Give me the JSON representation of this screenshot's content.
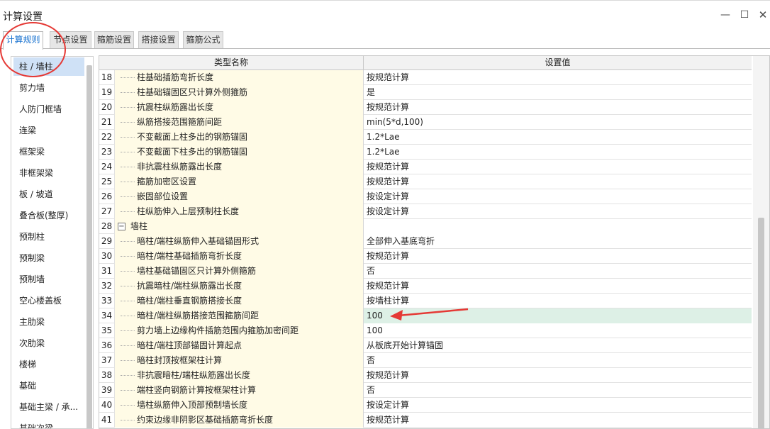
{
  "window": {
    "title": "计算设置",
    "controls": {
      "minimize": "—",
      "maximize": "☐",
      "close": "✕"
    }
  },
  "tabs": [
    {
      "label": "计算规则",
      "active": true
    },
    {
      "label": "节点设置",
      "active": false
    },
    {
      "label": "箍筋设置",
      "active": false
    },
    {
      "label": "搭接设置",
      "active": false
    },
    {
      "label": "箍筋公式",
      "active": false
    }
  ],
  "sidebar": {
    "items": [
      {
        "label": "柱 / 墙柱",
        "selected": true
      },
      {
        "label": "剪力墙",
        "selected": false
      },
      {
        "label": "人防门框墙",
        "selected": false
      },
      {
        "label": "连梁",
        "selected": false
      },
      {
        "label": "框架梁",
        "selected": false
      },
      {
        "label": "非框架梁",
        "selected": false
      },
      {
        "label": "板 / 坡道",
        "selected": false
      },
      {
        "label": "叠合板(整厚)",
        "selected": false
      },
      {
        "label": "预制柱",
        "selected": false
      },
      {
        "label": "预制梁",
        "selected": false
      },
      {
        "label": "预制墙",
        "selected": false
      },
      {
        "label": "空心楼盖板",
        "selected": false
      },
      {
        "label": "主肋梁",
        "selected": false
      },
      {
        "label": "次肋梁",
        "selected": false
      },
      {
        "label": "楼梯",
        "selected": false
      },
      {
        "label": "基础",
        "selected": false
      },
      {
        "label": "基础主梁 / 承...",
        "selected": false
      },
      {
        "label": "基础次梁",
        "selected": false
      }
    ]
  },
  "table": {
    "headers": {
      "type": "类型名称",
      "value": "设置值"
    },
    "rows": [
      {
        "num": "18",
        "name": "柱基础插筋弯折长度",
        "value": "按规范计算"
      },
      {
        "num": "19",
        "name": "柱基础锚固区只计算外侧箍筋",
        "value": "是"
      },
      {
        "num": "20",
        "name": "抗震柱纵筋露出长度",
        "value": "按规范计算"
      },
      {
        "num": "21",
        "name": "纵筋搭接范围箍筋间距",
        "value": "min(5*d,100)"
      },
      {
        "num": "22",
        "name": "不变截面上柱多出的钢筋锚固",
        "value": "1.2*Lae"
      },
      {
        "num": "23",
        "name": "不变截面下柱多出的钢筋锚固",
        "value": "1.2*Lae"
      },
      {
        "num": "24",
        "name": "非抗震柱纵筋露出长度",
        "value": "按规范计算"
      },
      {
        "num": "25",
        "name": "箍筋加密区设置",
        "value": "按规范计算"
      },
      {
        "num": "26",
        "name": "嵌固部位设置",
        "value": "按设定计算"
      },
      {
        "num": "27",
        "name": "柱纵筋伸入上层预制柱长度",
        "value": "按设定计算"
      },
      {
        "num": "28",
        "name": "墙柱",
        "value": "",
        "group": true,
        "expander": "−"
      },
      {
        "num": "29",
        "name": "暗柱/端柱纵筋伸入基础锚固形式",
        "value": "全部伸入基底弯折"
      },
      {
        "num": "30",
        "name": "暗柱/端柱基础插筋弯折长度",
        "value": "按规范计算"
      },
      {
        "num": "31",
        "name": "墙柱基础锚固区只计算外侧箍筋",
        "value": "否"
      },
      {
        "num": "32",
        "name": "抗震暗柱/端柱纵筋露出长度",
        "value": "按规范计算"
      },
      {
        "num": "33",
        "name": "暗柱/端柱垂直钢筋搭接长度",
        "value": "按墙柱计算"
      },
      {
        "num": "34",
        "name": "暗柱/端柱纵筋搭接范围箍筋间距",
        "value": "100",
        "highlight": true
      },
      {
        "num": "35",
        "name": "剪力墙上边缘构件插筋范围内箍筋加密间距",
        "value": "100"
      },
      {
        "num": "36",
        "name": "暗柱/端柱顶部锚固计算起点",
        "value": "从板底开始计算锚固"
      },
      {
        "num": "37",
        "name": "暗柱封顶按框架柱计算",
        "value": "否"
      },
      {
        "num": "38",
        "name": "非抗震暗柱/端柱纵筋露出长度",
        "value": "按规范计算"
      },
      {
        "num": "39",
        "name": "端柱竖向钢筋计算按框架柱计算",
        "value": "否"
      },
      {
        "num": "40",
        "name": "墙柱纵筋伸入顶部预制墙长度",
        "value": "按设定计算"
      },
      {
        "num": "41",
        "name": "约束边缘非阴影区基础插筋弯折长度",
        "value": "按规范计算"
      }
    ]
  },
  "colors": {
    "annotation_red": "#e53935",
    "name_cell_bg": "#fffbe6",
    "highlight_bg": "#ddf0e6",
    "selected_bg": "#cfe1f6",
    "active_tab_text": "#1a73d0"
  }
}
